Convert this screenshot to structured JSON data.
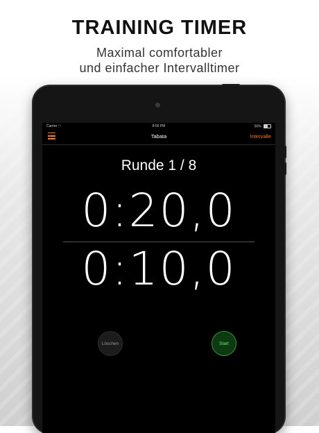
{
  "promo": {
    "headline": "TRAINING TIMER",
    "subline1": "Maximal comfortabler",
    "subline2": "und einfacher Intervalltimer"
  },
  "status_bar": {
    "carrier": "Carrier",
    "wifi_icon": "wifi-icon",
    "time": "8:59 PM",
    "battery_percent": "56%",
    "battery_level": 0.56
  },
  "nav": {
    "menu_icon": "hamburger-icon",
    "title": "Tabata",
    "right_label": "Intervalle"
  },
  "timer": {
    "round_label": "Runde 1 / 8",
    "primary_time": "0:20,0",
    "secondary_time": "0:10,0"
  },
  "buttons": {
    "clear_label": "Löschen",
    "start_label": "Start"
  },
  "colors": {
    "accent": "#ff7a1a",
    "start_green": "#5bff6b",
    "screen_bg": "#000000"
  }
}
